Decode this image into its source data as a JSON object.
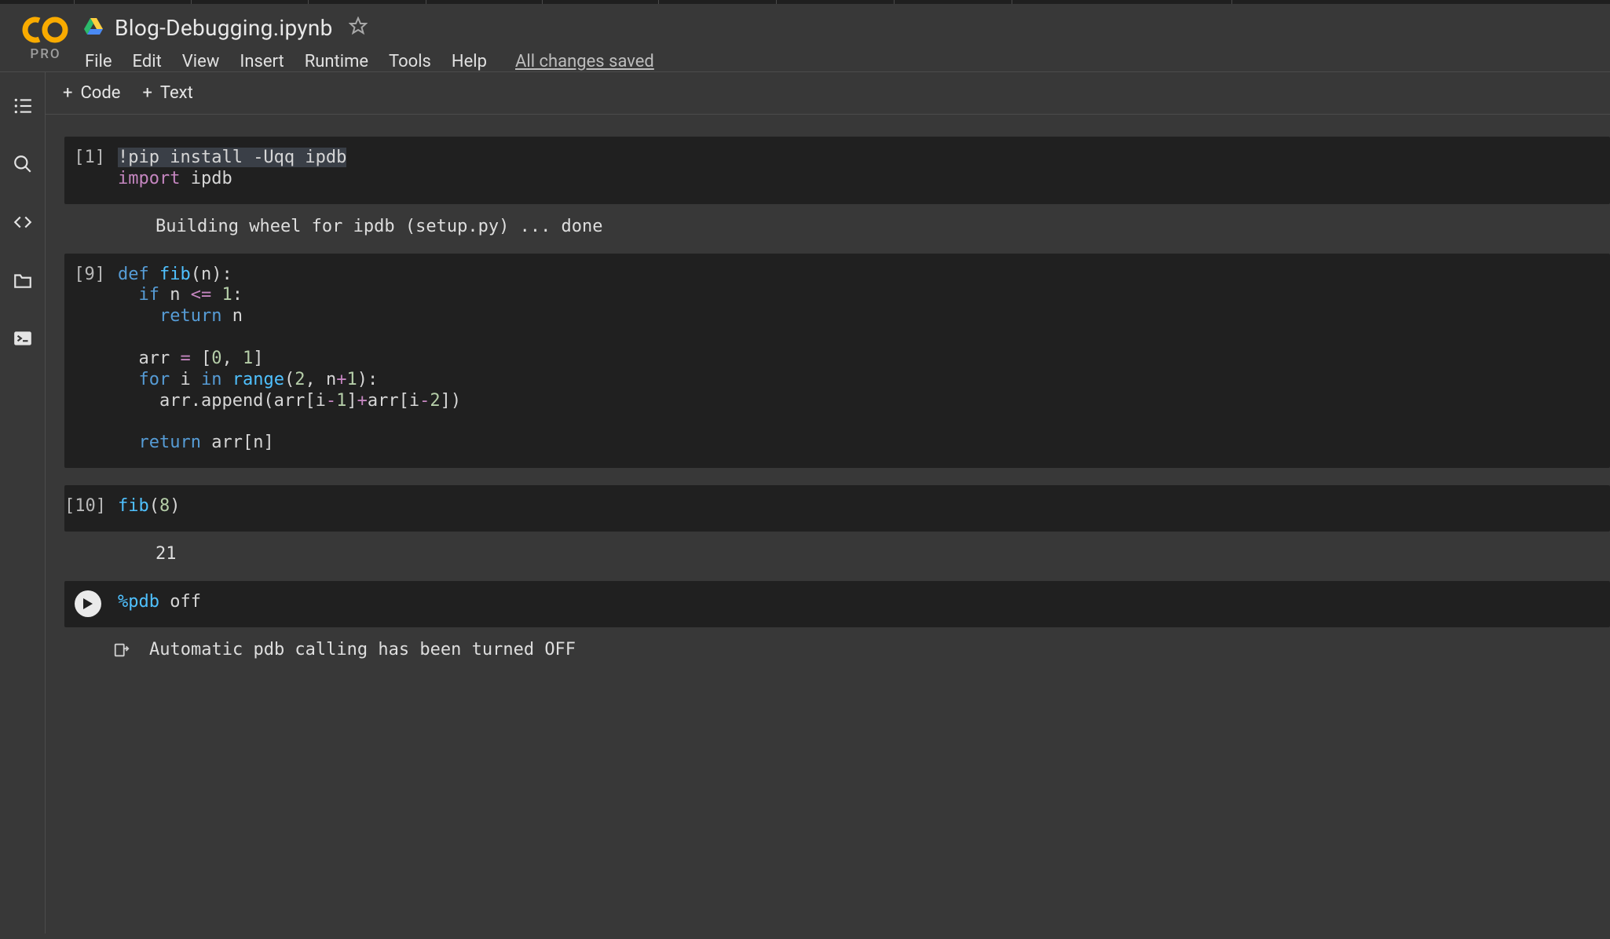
{
  "logo": {
    "pro_label": "PRO"
  },
  "notebook": {
    "title": "Blog-Debugging.ipynb"
  },
  "menubar": {
    "file": "File",
    "edit": "Edit",
    "view": "View",
    "insert": "Insert",
    "runtime": "Runtime",
    "tools": "Tools",
    "help": "Help",
    "save_state": "All changes saved"
  },
  "toolbar": {
    "code_label": "Code",
    "text_label": "Text"
  },
  "cells": [
    {
      "exec": "[1]",
      "code_html": "<span class='hl-sel'><span class='bang'>!</span>pip install -Uqq ipdb</span>\n<span class='kw2'>import</span> ipdb",
      "output": "Building wheel for ipdb (setup.py) ... done"
    },
    {
      "exec": "[9]",
      "code_html": "<span class='kw'>def</span> <span class='fn'>fib</span>(n):\n  <span class='kw'>if</span> n <span class='op'>&lt;=</span> <span class='num'>1</span>:\n    <span class='kw'>return</span> n\n\n  arr <span class='op'>=</span> [<span class='num'>0</span>, <span class='num'>1</span>]\n  <span class='kw'>for</span> i <span class='kw'>in</span> <span class='fn'>range</span>(<span class='num'>2</span>, n<span class='op'>+</span><span class='num'>1</span>):\n    arr.append(arr[i<span class='op'>-</span><span class='num'>1</span>]<span class='op'>+</span>arr[i<span class='op'>-</span><span class='num'>2</span>])\n\n  <span class='kw'>return</span> arr[n]",
      "output": ""
    },
    {
      "exec": "[10]",
      "code_html": "<span class='fn'>fib</span>(<span class='num'>8</span>)",
      "output": "21"
    },
    {
      "exec": "run",
      "code_html": "<span class='magic'>%pdb</span> off",
      "output": "Automatic pdb calling has been turned OFF",
      "output_icon": true
    }
  ]
}
